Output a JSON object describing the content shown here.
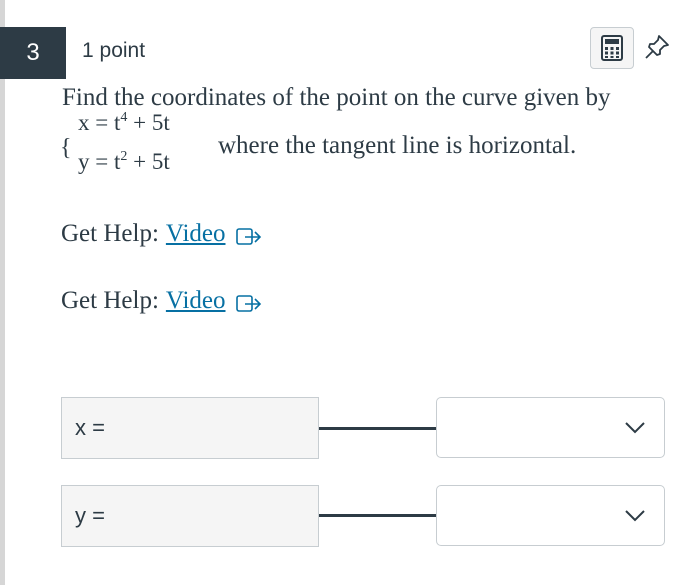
{
  "question": {
    "number": "3",
    "points": "1 point",
    "prompt": "Find the coordinates of the point on the curve given by",
    "system": {
      "brace": "{",
      "x_eq": "x = t",
      "x_exp": "4",
      "x_rest": " + 5t",
      "y_eq": "y = t",
      "y_exp": "2",
      "y_rest": " + 5t"
    },
    "condition": "where the tangent line is horizontal."
  },
  "help": [
    {
      "label": "Get Help:",
      "link": "Video"
    },
    {
      "label": "Get Help:",
      "link": "Video"
    }
  ],
  "answers": [
    {
      "label": "x =",
      "selected": ""
    },
    {
      "label": "y =",
      "selected": ""
    }
  ],
  "icons": {
    "calculator": "calculator-icon",
    "pin": "pin-icon",
    "external_link": "external-link-icon",
    "dropdown": "chevron-down-icon"
  },
  "colors": {
    "badge_bg": "#2d3b45",
    "link": "#0770a3",
    "border": "#c7cdd1",
    "label_bg": "#f5f5f5"
  }
}
